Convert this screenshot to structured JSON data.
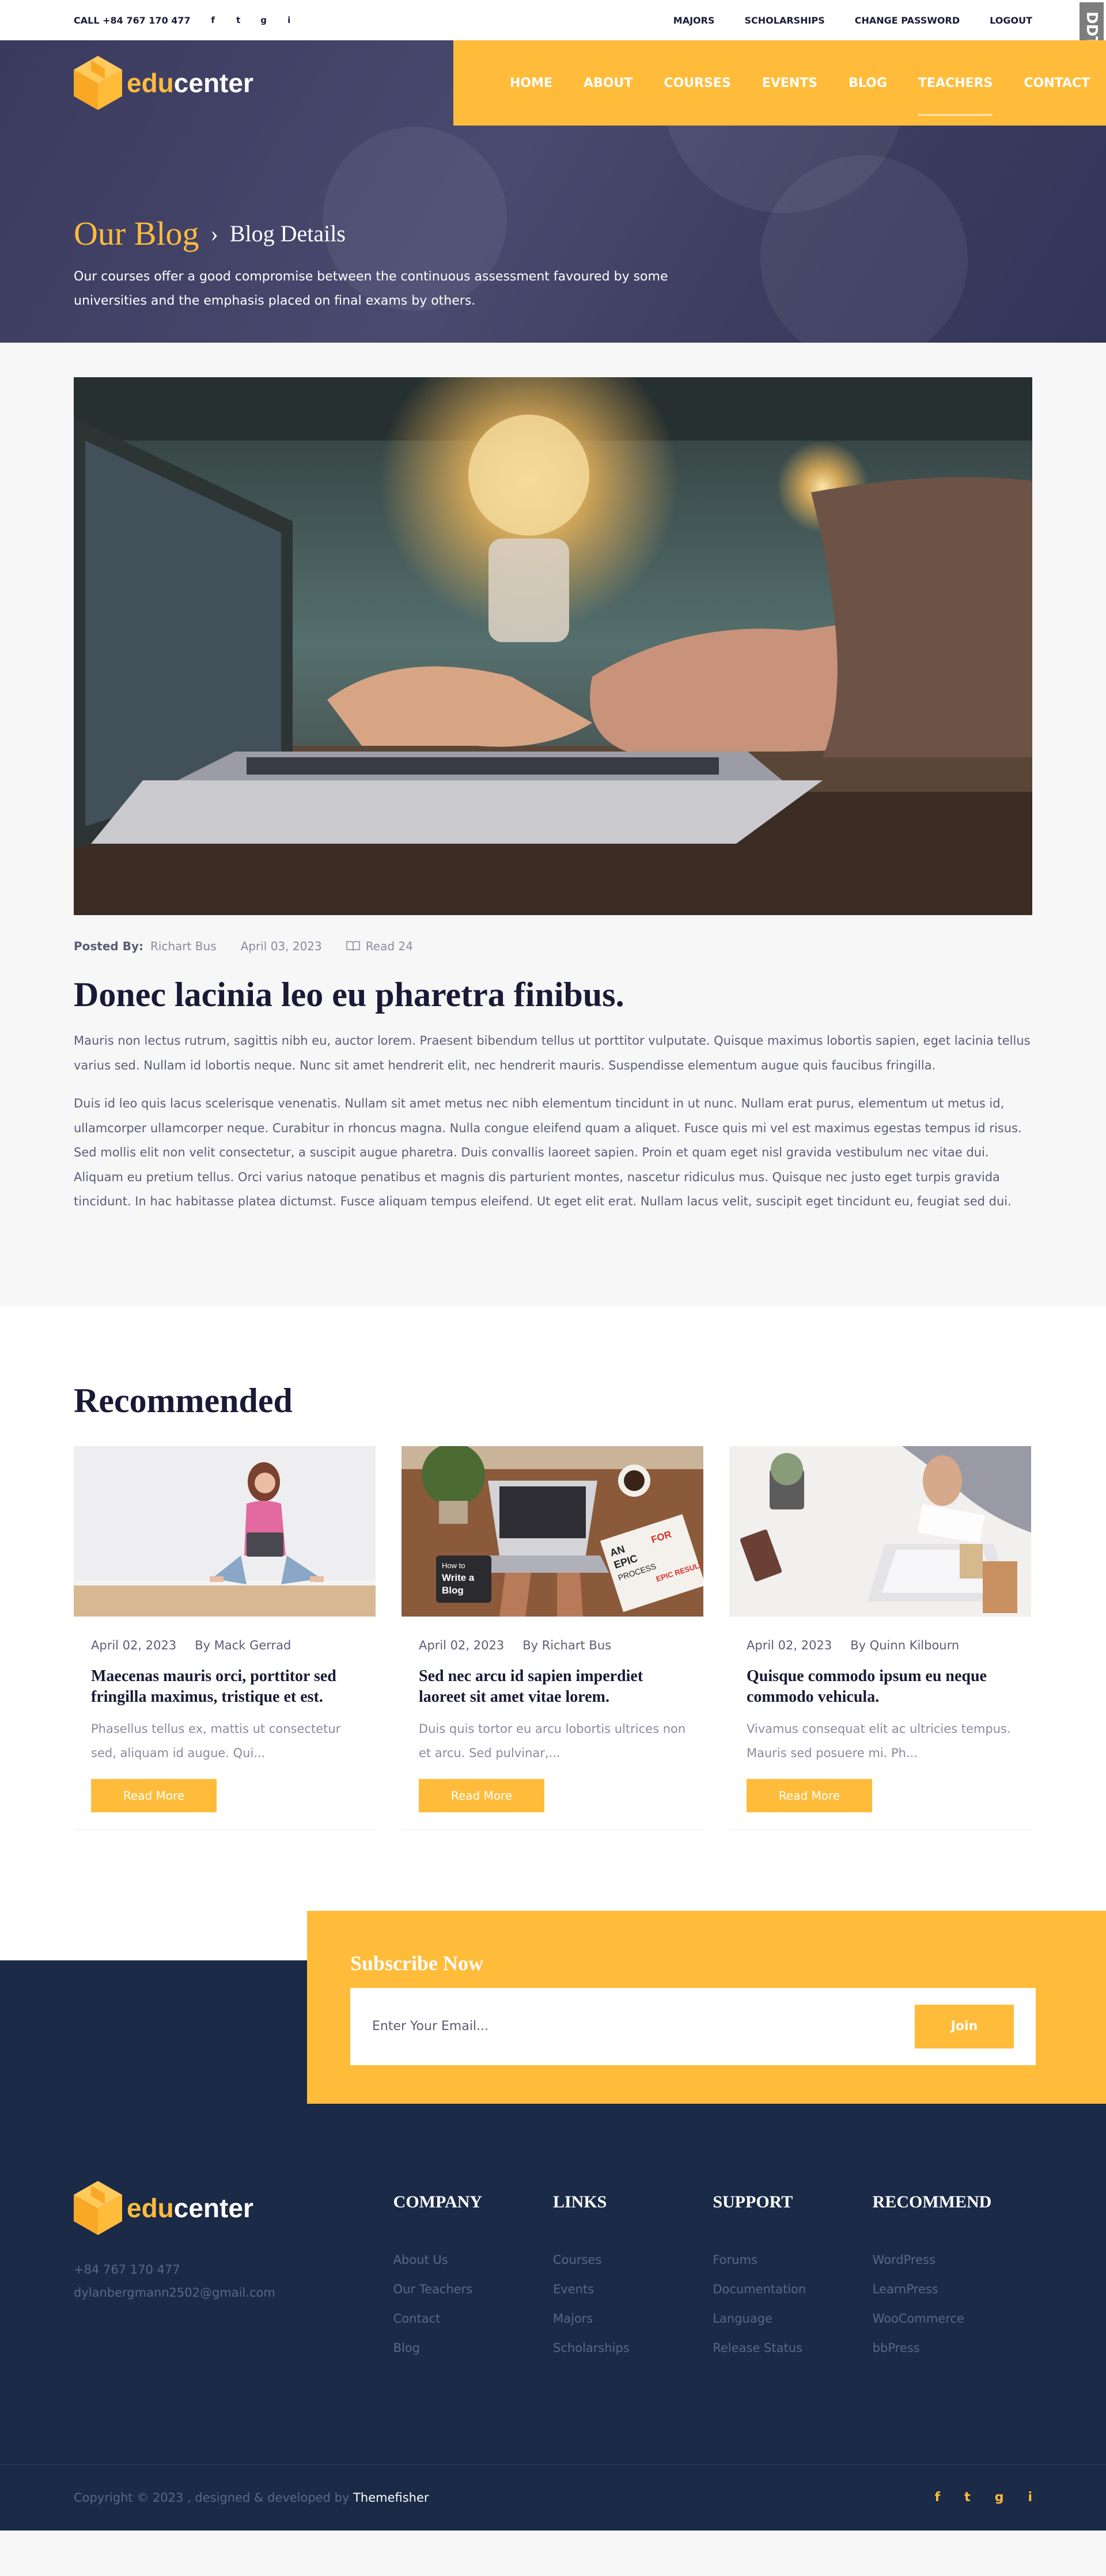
{
  "topbar": {
    "call": "CALL +84 767 170 477",
    "social": [
      "f",
      "t",
      "g",
      "i"
    ],
    "links": [
      "MAJORS",
      "SCHOLARSHIPS",
      "CHANGE PASSWORD",
      "LOGOUT"
    ],
    "badge": "DDT"
  },
  "brand": {
    "edu": "edu",
    "center": "center"
  },
  "nav": [
    "HOME",
    "ABOUT",
    "COURSES",
    "EVENTS",
    "BLOG",
    "TEACHERS",
    "CONTACT"
  ],
  "hero": {
    "title": "Our Blog",
    "crumb": "Blog Details",
    "text": "Our courses offer a good compromise between the continuous assessment favoured by some universities and the emphasis placed on final exams by others."
  },
  "article": {
    "posted_label": "Posted By:",
    "author": "Richart Bus",
    "date": "April 03, 2023",
    "reads": "Read 24",
    "title": "Donec lacinia leo eu pharetra finibus.",
    "p1": "Mauris non lectus rutrum, sagittis nibh eu, auctor lorem. Praesent bibendum tellus ut porttitor vulputate. Quisque maximus lobortis sapien, eget lacinia tellus varius sed. Nullam id lobortis neque. Nunc sit amet hendrerit elit, nec hendrerit mauris. Suspendisse elementum augue quis faucibus fringilla.",
    "p2": "Duis id leo quis lacus scelerisque venenatis. Nullam sit amet metus nec nibh elementum tincidunt in ut nunc. Nullam erat purus, elementum ut metus id, ullamcorper ullamcorper neque. Curabitur in rhoncus magna. Nulla congue eleifend quam a aliquet. Fusce quis mi vel est maximus egestas tempus id risus. Sed mollis elit non velit consectetur, a suscipit augue pharetra. Duis convallis laoreet sapien. Proin et quam eget nisl gravida vestibulum nec vitae dui. Aliquam eu pretium tellus. Orci varius natoque penatibus et magnis dis parturient montes, nascetur ridiculus mus. Quisque nec justo eget turpis gravida tincidunt. In hac habitasse platea dictumst. Fusce aliquam tempus eleifend. Ut eget elit erat. Nullam lacus velit, suscipit eget tincidunt eu, feugiat sed dui."
  },
  "recommended": {
    "heading": "Recommended",
    "cards": [
      {
        "date": "April 02, 2023",
        "by": "By Mack Gerrad",
        "title": "Maecenas mauris orci, porttitor sed fringilla maximus, tristique et est.",
        "excerpt": "Phasellus tellus ex, mattis ut consectetur sed, aliquam id augue. Qui...",
        "button": "Read More"
      },
      {
        "date": "April 02, 2023",
        "by": "By Richart Bus",
        "title": "Sed nec arcu id sapien imperdiet laoreet sit amet vitae lorem.",
        "excerpt": "Duis quis tortor eu arcu lobortis ultrices non et arcu. Sed pulvinar,...",
        "button": "Read More"
      },
      {
        "date": "April 02, 2023",
        "by": "By Quinn Kilbourn",
        "title": "Quisque commodo ipsum eu neque commodo vehicula.",
        "excerpt": "Vivamus consequat elit ac ultricies tempus. Mauris sed posuere mi. Ph...",
        "button": "Read More"
      }
    ],
    "book_text": {
      "how": "How to",
      "write": "Write a",
      "blog": "Blog",
      "an": "AN",
      "epic": "EPIC",
      "process": "PROCESS",
      "for": "FOR",
      "results": "EPIC RESULTS"
    }
  },
  "subscribe": {
    "title": "Subscribe Now",
    "placeholder": "Enter Your Email...",
    "button": "Join"
  },
  "footer": {
    "phone": "+84 767 170 477",
    "email": "dylanbergmann2502@gmail.com",
    "columns": [
      {
        "title": "COMPANY",
        "items": [
          "About Us",
          "Our Teachers",
          "Contact",
          "Blog"
        ]
      },
      {
        "title": "LINKS",
        "items": [
          "Courses",
          "Events",
          "Majors",
          "Scholarships"
        ]
      },
      {
        "title": "SUPPORT",
        "items": [
          "Forums",
          "Documentation",
          "Language",
          "Release Status"
        ]
      },
      {
        "title": "RECOMMEND",
        "items": [
          "WordPress",
          "LearnPress",
          "WooCommerce",
          "bbPress"
        ]
      }
    ],
    "copyright": "Copyright © 2023 , designed & developed by",
    "credit": "Themefisher",
    "social": [
      "f",
      "t",
      "g",
      "i"
    ]
  },
  "colors": {
    "accent": "#ffbc3b",
    "navy": "#1a2a47",
    "heading": "#1a1a37"
  }
}
